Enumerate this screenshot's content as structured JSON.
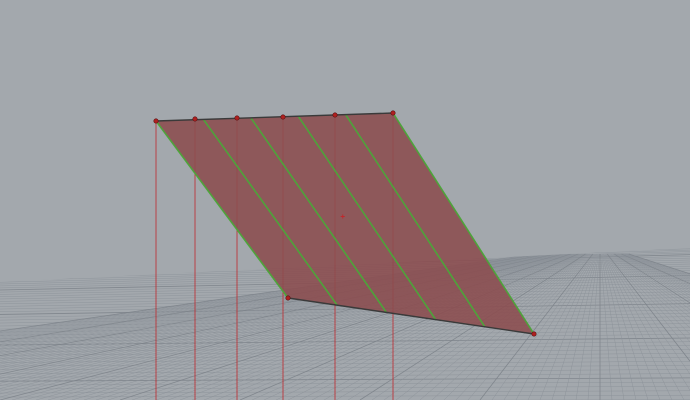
{
  "viewport": {
    "background_color": "#a3a8ad",
    "grid_color": "#8c9299",
    "grid_major_color": "#7d838a"
  },
  "surface": {
    "fill_color": "#8b4c4f",
    "fill_opacity": 0.88,
    "edge_color": "#3a3a3a",
    "isocurve_color": "#4da43a",
    "control_line_color": "#c0282c",
    "control_point_color": "#b02020",
    "top_control_point_count": 6,
    "isocurve_count": 6
  }
}
